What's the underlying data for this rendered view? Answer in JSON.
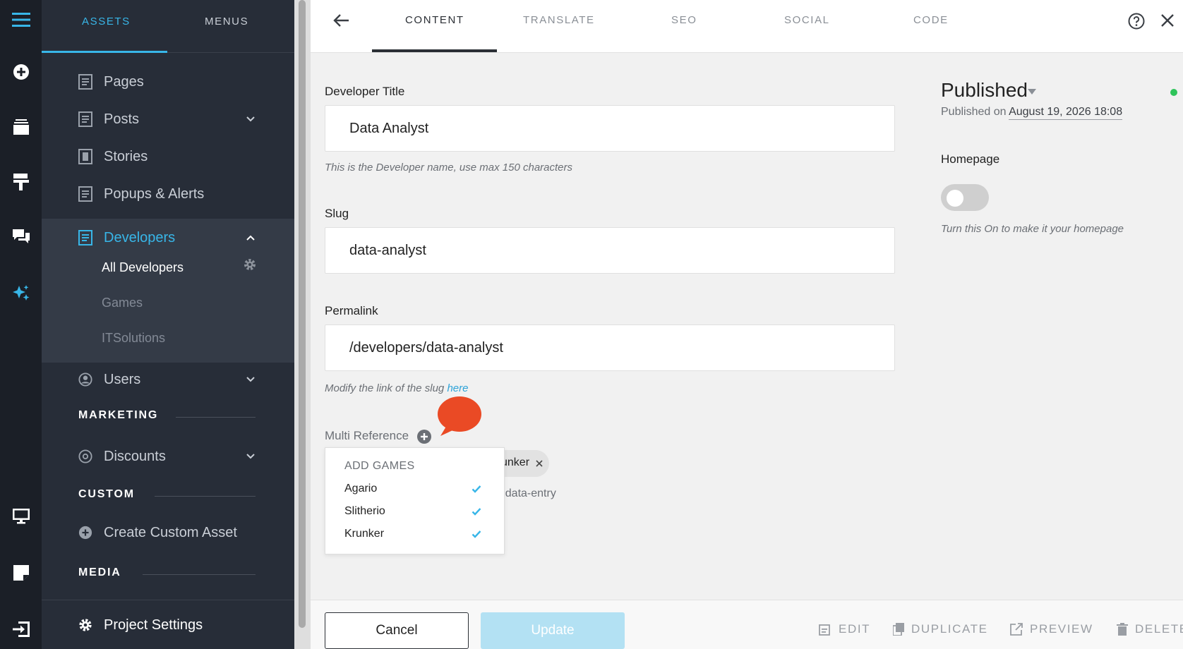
{
  "sidebar": {
    "tabs": [
      "ASSETS",
      "MENUS"
    ],
    "items": {
      "pages": "Pages",
      "posts": "Posts",
      "stories": "Stories",
      "popups": "Popups & Alerts",
      "developers": "Developers",
      "users": "Users",
      "discounts": "Discounts",
      "create_custom": "Create Custom Asset"
    },
    "sub_items": [
      "All Developers",
      "Games",
      "ITSolutions"
    ],
    "sections": {
      "marketing": "MARKETING",
      "custom": "CUSTOM",
      "media": "MEDIA"
    },
    "footer": "Project Settings"
  },
  "topbar": {
    "tabs": [
      "CONTENT",
      "TRANSLATE",
      "SEO",
      "SOCIAL",
      "CODE"
    ]
  },
  "form": {
    "title_label": "Developer Title",
    "title_value": "Data Analyst",
    "title_help": "This is the Developer name, use max 150 characters",
    "slug_label": "Slug",
    "slug_value": "data-analyst",
    "permalink_label": "Permalink",
    "permalink_value": "/developers/data-analyst",
    "permalink_help": "Modify the link of the slug",
    "permalink_help_link": "here",
    "multiref_label": "Multi Reference",
    "tag_visible": "unker",
    "behind_text": "r data-entry"
  },
  "dropdown": {
    "header": "ADD GAMES",
    "items": [
      "Agario",
      "Slitherio",
      "Krunker"
    ]
  },
  "status": {
    "label": "Published",
    "published_on_label": "Published on",
    "published_on_value": "August 19, 2026 18:08",
    "homepage_label": "Homepage",
    "homepage_help": "Turn this On to make it your homepage",
    "dot_color": "#2ec45a"
  },
  "bottom": {
    "cancel": "Cancel",
    "update": "Update",
    "actions": [
      "EDIT",
      "DUPLICATE",
      "PREVIEW",
      "DELETE"
    ]
  },
  "colors": {
    "accent": "#38b6e8",
    "sidebar_bg": "#272d38",
    "rail_bg": "#1b1f27",
    "bubble": "#ea4a25"
  }
}
